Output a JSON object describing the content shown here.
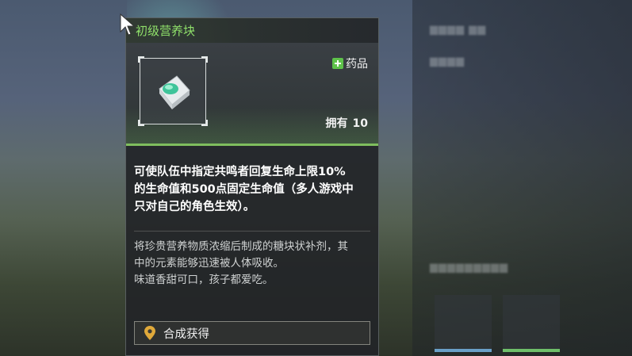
{
  "tooltip": {
    "title": "初级营养块",
    "category": "药品",
    "owned_label": "拥有",
    "owned_count": "10",
    "effect_lines": [
      "可使队伍中指定共鸣者回复生命上限10%",
      "的生命值和500点固定生命值（多人游戏中",
      "只对自己的角色生效）。"
    ],
    "description_lines": [
      "将珍贵营养物质浓缩后制成的糖块状补剂，其",
      "中的元素能够迅速被人体吸收。",
      "味道香甜可口，孩子都爱吃。"
    ],
    "source_button": "合成获得"
  },
  "colors": {
    "title_green": "#8fe06a",
    "accent_green": "#7fbe5e",
    "category_icon": "#5ec24a",
    "pin_icon": "#e0a93a"
  },
  "icons": {
    "category": "plus-icon",
    "source": "location-pin-icon",
    "item": "nutrition-block-item-icon"
  }
}
